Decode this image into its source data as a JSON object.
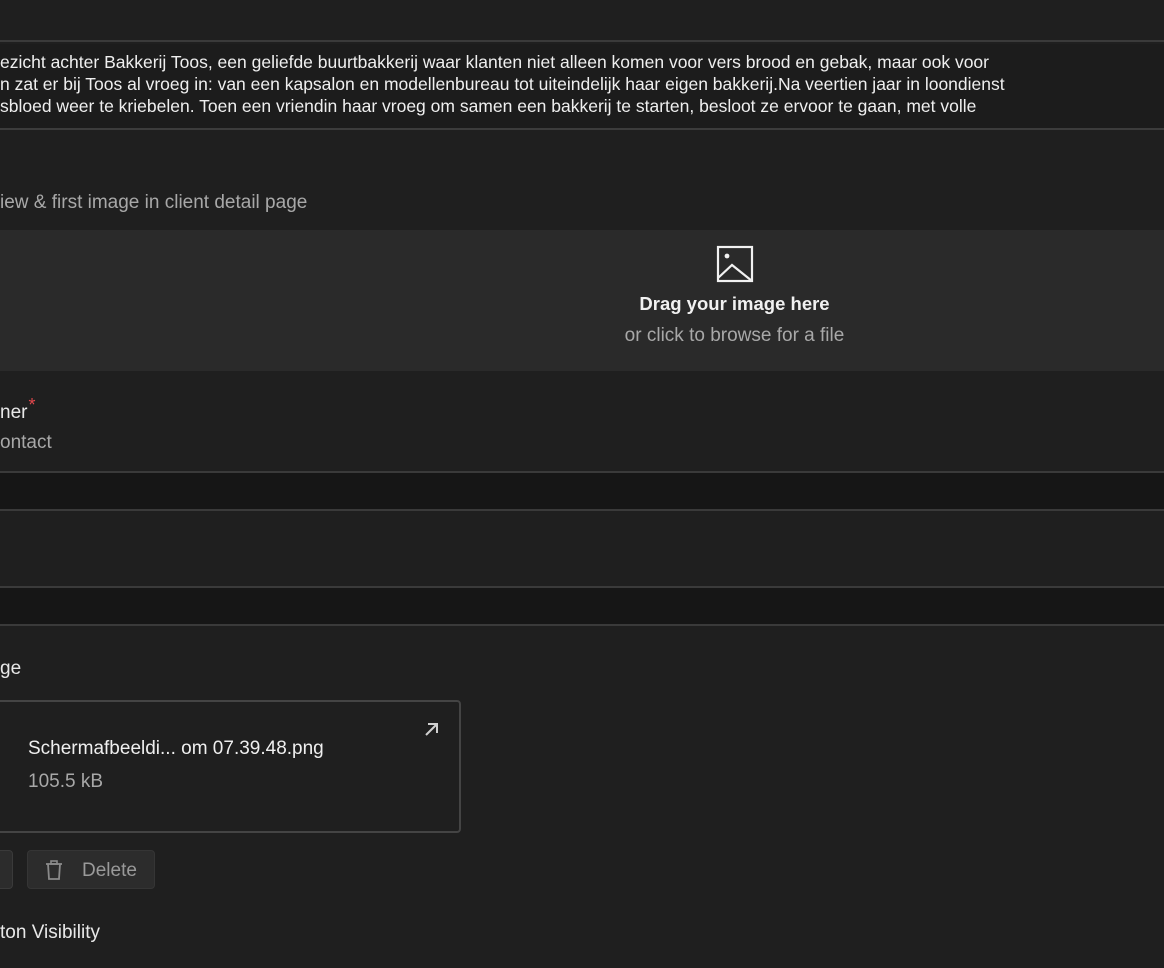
{
  "description_text": {
    "lines": [
      "ezicht achter Bakkerij Toos, een geliefde buurtbakkerij waar klanten niet alleen komen voor vers brood en gebak, maar ook voor",
      "n zat er bij Toos al vroeg in: van een kapsalon en modellenbureau tot uiteindelijk haar eigen bakkerij.Na veertien jaar in loondienst",
      "sbloed weer te kriebelen. Toen een vriendin haar vroeg om samen een bakkerij te starten, besloot ze ervoor te gaan, met volle"
    ]
  },
  "image_field": {
    "hint": "iew & first image in client detail page",
    "dropzone_title": "Drag your image here",
    "dropzone_subtitle": "or click to browse for a file"
  },
  "owner_field": {
    "label": "ner",
    "required_marker": "*",
    "sublabel": "ontact"
  },
  "image_upload": {
    "label": "ge",
    "file_name": "Schermafbeeldi... om 07.39.48.png",
    "file_size": "105.5 kB",
    "delete_label": "Delete"
  },
  "visibility_field": {
    "label": "ton Visibility"
  },
  "colors": {
    "background": "#1f1f1f",
    "dropzone": "#2a2a2a",
    "required": "#e5484d",
    "muted_text": "#a8a8a8"
  }
}
